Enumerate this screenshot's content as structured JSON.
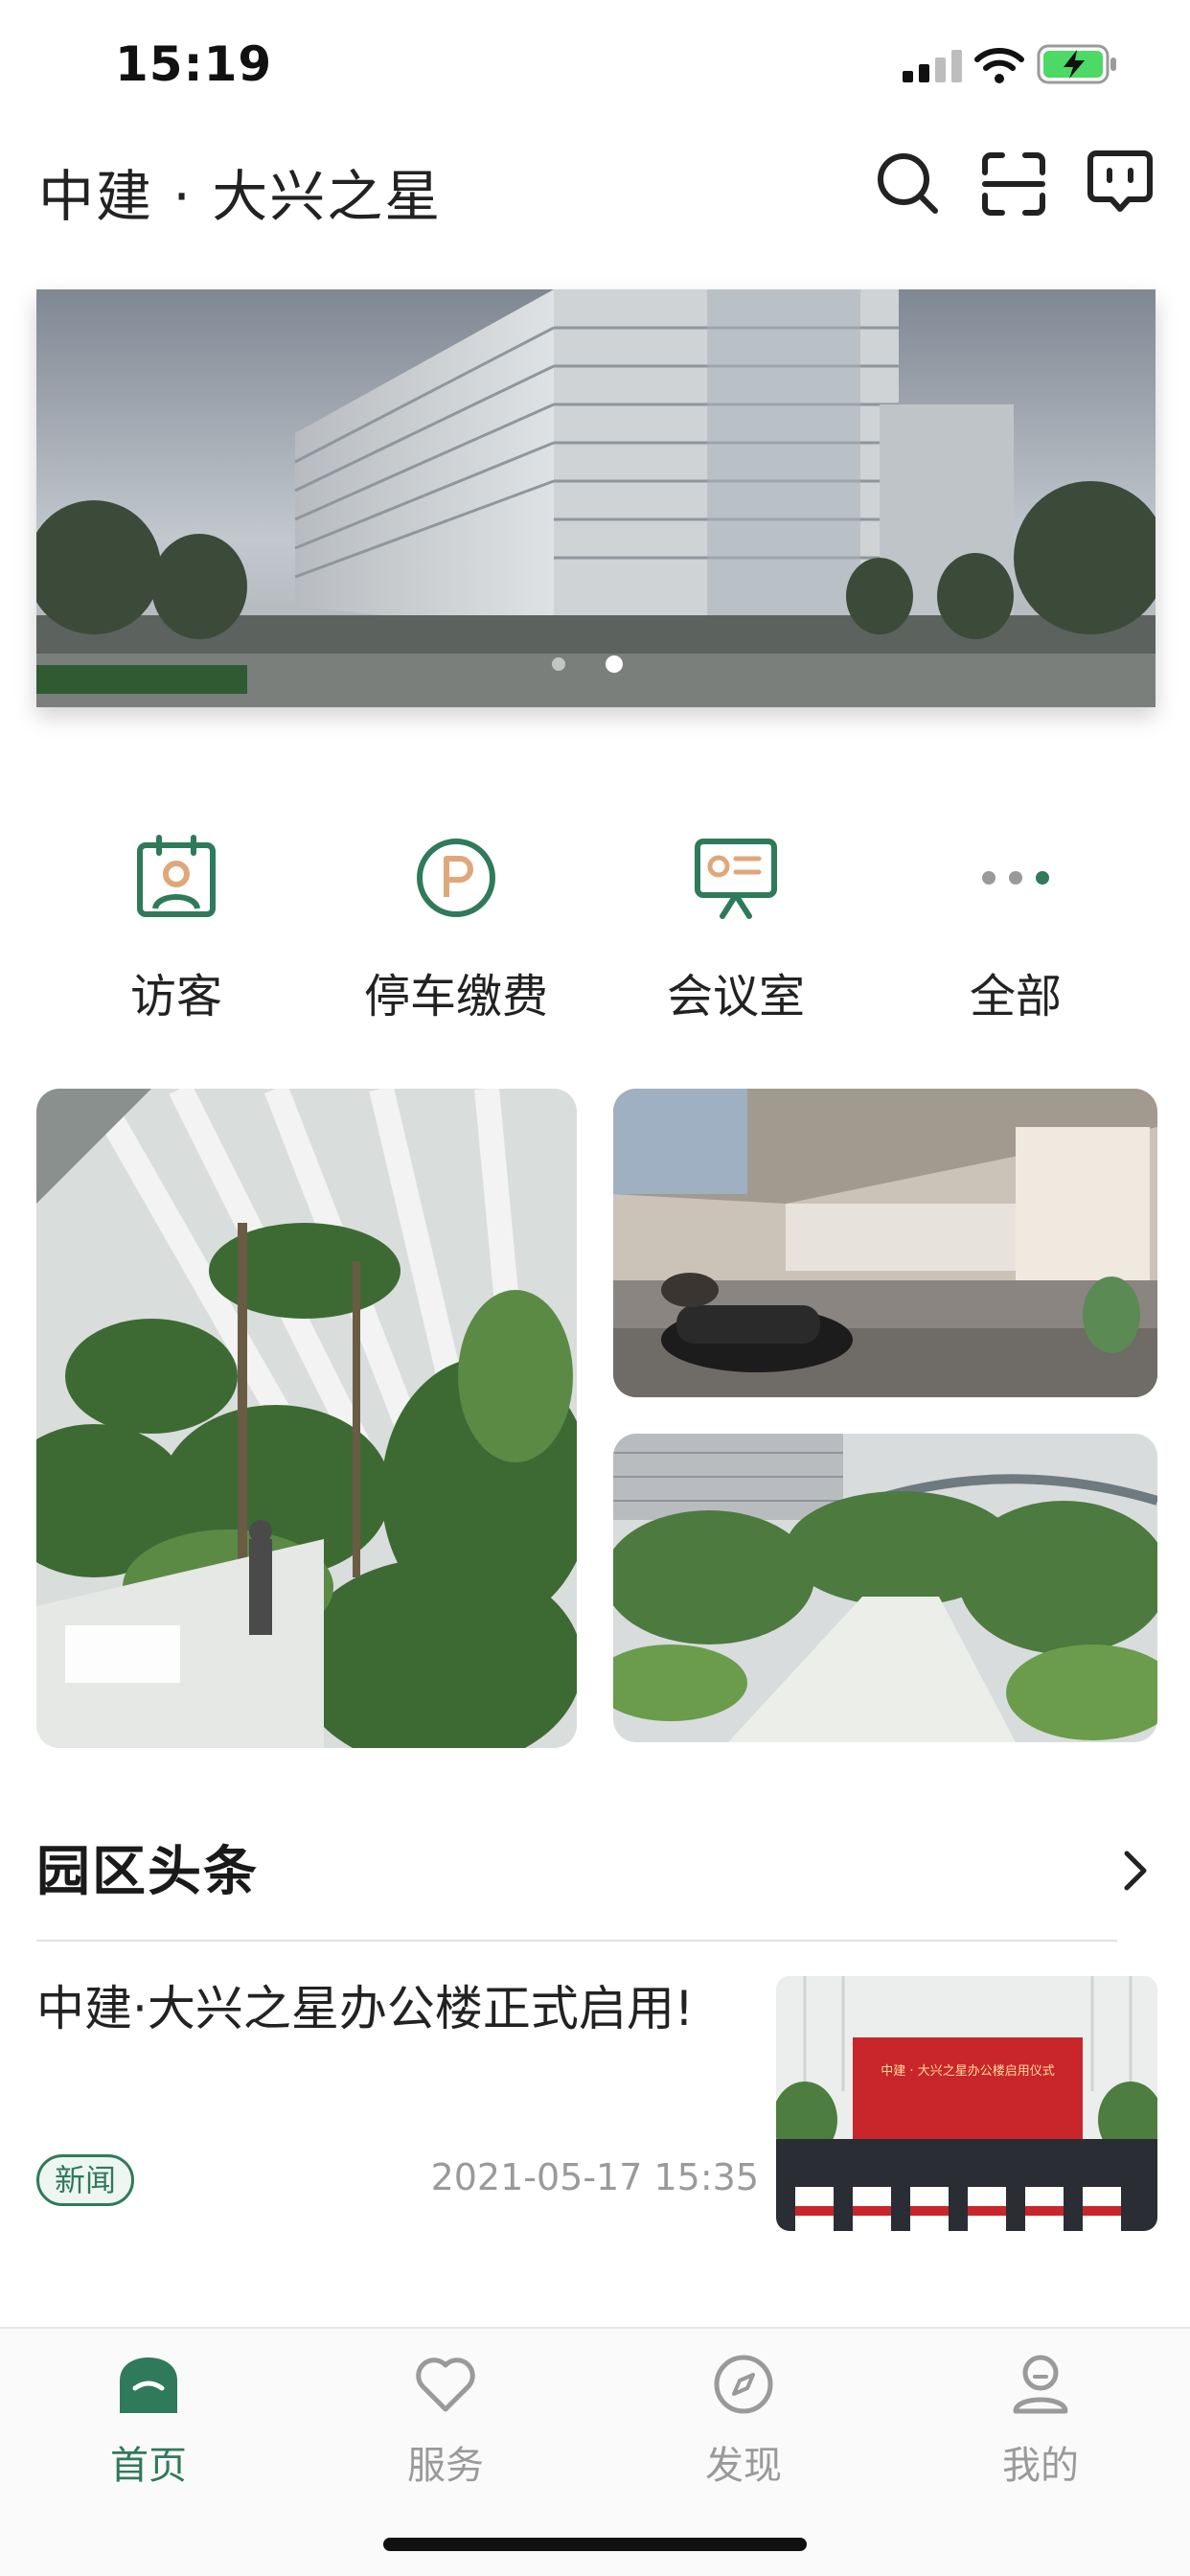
{
  "status_bar": {
    "time": "15:19"
  },
  "header": {
    "title": "中建 · 大兴之星",
    "icons": [
      "search-icon",
      "scan-icon",
      "message-icon"
    ]
  },
  "banner": {
    "slide_count": 2,
    "active_slide": 2
  },
  "quick_menu": [
    {
      "label": "访客",
      "icon": "visitor-icon"
    },
    {
      "label": "停车缴费",
      "icon": "parking-icon"
    },
    {
      "label": "会议室",
      "icon": "meeting-room-icon"
    },
    {
      "label": "全部",
      "icon": "more-icon"
    }
  ],
  "news": {
    "section_title": "园区头条",
    "items": [
      {
        "title": "中建·大兴之星办公楼正式启用!",
        "tag": "新闻",
        "time": "2021-05-17 15:35",
        "thumbnail_banner_text": "中建 · 大兴之星办公楼启用仪式"
      }
    ]
  },
  "tab_bar": [
    {
      "label": "首页",
      "icon": "home-icon",
      "active": true
    },
    {
      "label": "服务",
      "icon": "heart-icon",
      "active": false
    },
    {
      "label": "发现",
      "icon": "compass-icon",
      "active": false
    },
    {
      "label": "我的",
      "icon": "profile-icon",
      "active": false
    }
  ],
  "colors": {
    "accent": "#2f7a5b",
    "muted": "#9a9a9a",
    "icon_orange": "#e0a77a"
  }
}
